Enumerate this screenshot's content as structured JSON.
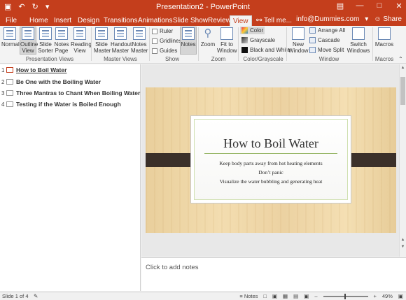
{
  "window": {
    "title": "Presentation2 - PowerPoint",
    "min_glyph": "—",
    "max_glyph": "□",
    "close_glyph": "✕"
  },
  "qat": {
    "undo": "↶",
    "redo": "↻",
    "dropdown": "▾"
  },
  "tabs": [
    "File",
    "Home",
    "Insert",
    "Design",
    "Transitions",
    "Animations",
    "Slide Show",
    "Review",
    "View"
  ],
  "active_tab": "View",
  "tell_me": "Tell me...",
  "account": "info@Dummies.com",
  "share": "Share",
  "ribbon": {
    "presentation_views": {
      "label": "Presentation Views",
      "buttons": [
        "Normal",
        "Outline\nView",
        "Slide\nSorter",
        "Notes\nPage",
        "Reading\nView"
      ]
    },
    "master_views": {
      "label": "Master Views",
      "buttons": [
        "Slide\nMaster",
        "Handout\nMaster",
        "Notes\nMaster"
      ]
    },
    "show": {
      "label": "Show",
      "checks": [
        "Ruler",
        "Gridlines",
        "Guides"
      ],
      "notes": "Notes"
    },
    "zoom": {
      "label": "Zoom",
      "buttons": [
        "Zoom",
        "Fit to\nWindow"
      ]
    },
    "color": {
      "label": "Color/Grayscale",
      "options": [
        "Color",
        "Grayscale",
        "Black and White"
      ]
    },
    "window": {
      "label": "Window",
      "new_window": "New\nWindow",
      "options": [
        "Arrange All",
        "Cascade",
        "Move Split"
      ],
      "switch": "Switch\nWindows"
    },
    "macros": {
      "label": "Macros",
      "button": "Macros"
    }
  },
  "outline": [
    {
      "num": "1",
      "text": "How to Boil Water"
    },
    {
      "num": "2",
      "text": "Be One with the Boiling Water"
    },
    {
      "num": "3",
      "text": "Three Mantras to Chant When Boiling Water"
    },
    {
      "num": "4",
      "text": "Testing if the Water is Boiled Enough"
    }
  ],
  "slide": {
    "title": "How to Boil Water",
    "bullets": [
      "Keep body parts away from hot heating elements",
      "Don’t panic",
      "Visualize the water bubbling and generating heat"
    ]
  },
  "notes_placeholder": "Click to add notes",
  "status": {
    "slide_info": "Slide 1 of 4",
    "notes": "Notes",
    "zoom": "49%"
  }
}
